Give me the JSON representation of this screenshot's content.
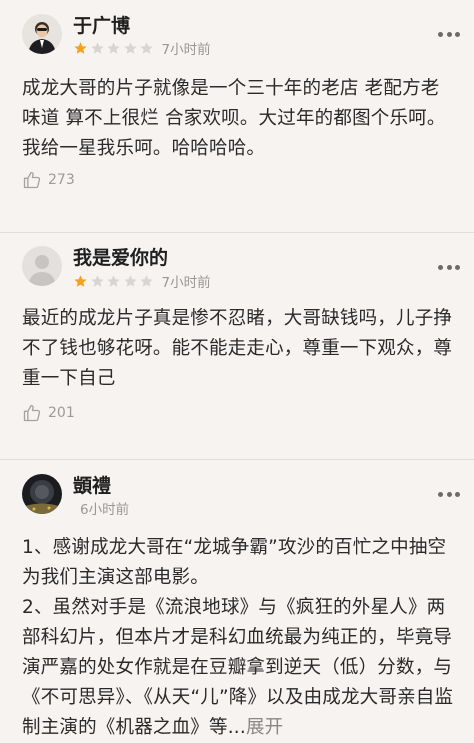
{
  "reviews": [
    {
      "username": "于广博",
      "rating": 1,
      "rating_max": 5,
      "time": "7小时前",
      "paragraphs": [
        "成龙大哥的片子就像是一个三十年的老店 老配方老味道 算不上很烂 合家欢呗。大过年的都图个乐呵。我给一星我乐呵。哈哈哈哈。"
      ],
      "likes": "273"
    },
    {
      "username": "我是爱你的",
      "rating": 1,
      "rating_max": 5,
      "time": "7小时前",
      "paragraphs": [
        "最近的成龙片子真是惨不忍睹，大哥缺钱吗，儿子挣不了钱也够花呀。能不能走走心，尊重一下观众，尊重一下自己"
      ],
      "likes": "201"
    },
    {
      "username": "顗禮",
      "time": "6小时前",
      "paragraphs": [
        "1、感谢成龙大哥在“龙城争霸”攻沙的百忙之中抽空为我们主演这部电影。",
        "2、虽然对手是《流浪地球》与《疯狂的外星人》两部科幻片，但本片才是科幻血统最为纯正的，毕竟导演严嘉的处女作就是在豆瓣拿到逆天（低）分数，与《不可思异》、《从天“儿”降》以及由成龙大哥亲自监制主演的《机器之血》等..."
      ],
      "expand_label": "展开"
    }
  ],
  "colors": {
    "star_on": "#f3a21c",
    "star_off": "#d9d5d3",
    "background": "#f7f3f1"
  }
}
